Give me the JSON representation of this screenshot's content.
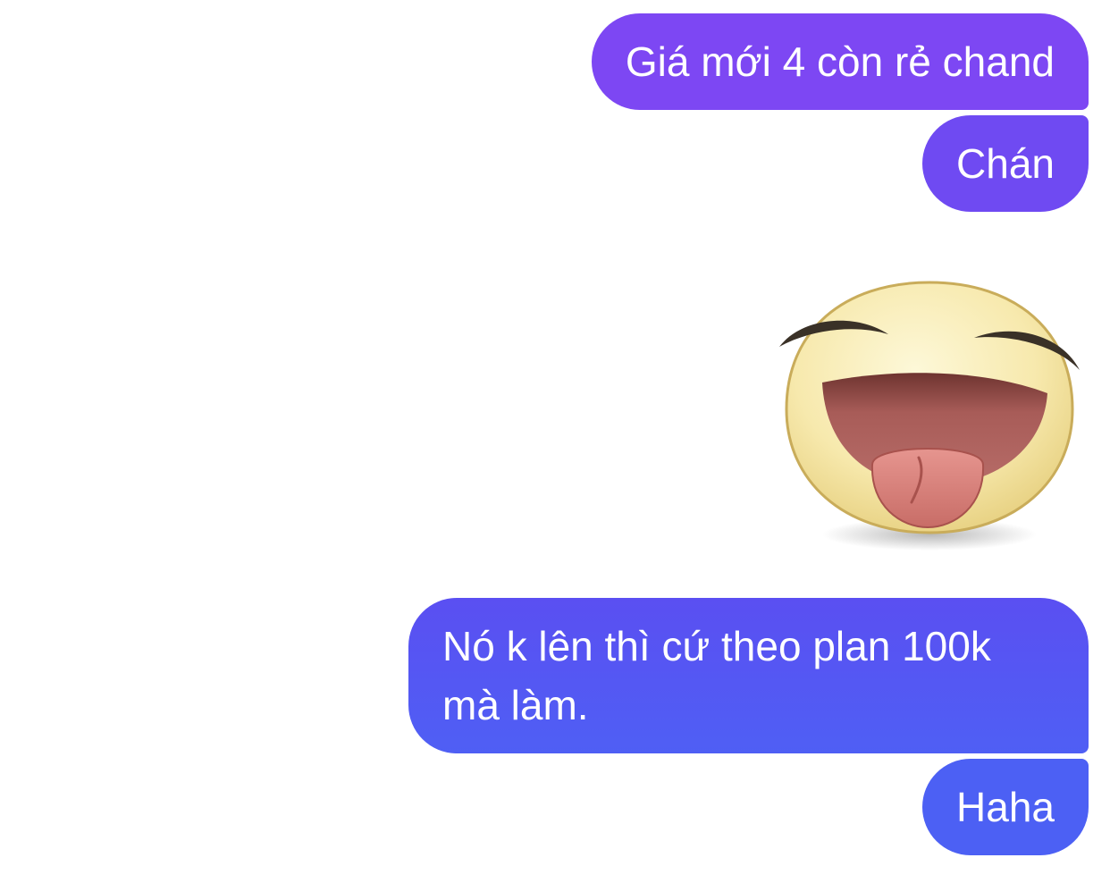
{
  "messages": [
    {
      "text": "Giá mới 4 còn rẻ chand"
    },
    {
      "text": "Chán"
    },
    {
      "sticker": "laughing-tongue-out-emoji"
    },
    {
      "lines": [
        "Nó k lên thì cứ theo plan 100k",
        "mà làm."
      ]
    },
    {
      "text": "Haha"
    }
  ],
  "colors": {
    "bubble_1": "#7d47f3",
    "bubble_2": "#6f4af2",
    "bubble_3_top": "#5a4ff2",
    "bubble_3_bottom": "#4f5ff4",
    "bubble_4": "#4c60f4",
    "text": "#ffffff",
    "background": "#ffffff"
  }
}
